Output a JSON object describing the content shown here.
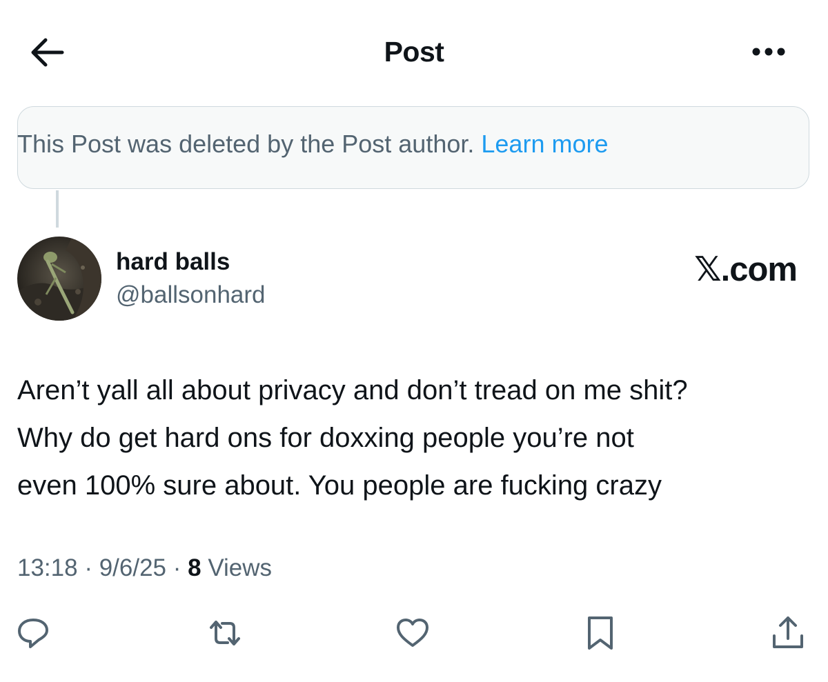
{
  "header": {
    "title": "Post",
    "back_icon": "arrow-left-icon",
    "more_icon": "ellipsis-icon"
  },
  "deleted_notice": {
    "text": "This Post was deleted by the Post author. ",
    "link": "Learn more"
  },
  "author": {
    "display_name": "hard balls",
    "handle": "@ballsonhard"
  },
  "source_label": "𝕏.com",
  "post": {
    "lines": [
      "Aren’t yall all about privacy and don’t tread on me shit?",
      "Why do get hard ons for doxxing people you’re not",
      "even 100% sure about. You people are fucking crazy"
    ]
  },
  "meta": {
    "time": "13:18",
    "separator": " · ",
    "date": "9/6/25",
    "views_count": "8",
    "views_label": " Views"
  },
  "actions": [
    {
      "name": "reply",
      "icon": "reply-icon"
    },
    {
      "name": "repost",
      "icon": "repost-icon"
    },
    {
      "name": "like",
      "icon": "heart-icon"
    },
    {
      "name": "bookmark",
      "icon": "bookmark-icon"
    },
    {
      "name": "share",
      "icon": "share-icon"
    }
  ],
  "colors": {
    "text": "#0f1419",
    "secondary": "#536471",
    "link": "#1d9bf0",
    "border": "#cfd9de",
    "notice_bg": "#f7f9f9"
  }
}
